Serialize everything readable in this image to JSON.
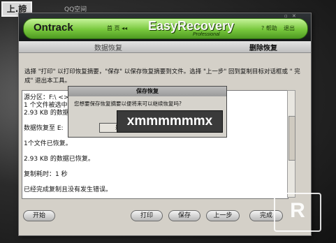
{
  "background": {
    "badge": "上.諦",
    "title": "QQ空间"
  },
  "header": {
    "brand_left": "Ontrack",
    "home_label": "首 页 ◂◂",
    "brand_main": "EasyRecovery",
    "brand_sub": "Professional",
    "help_label": "? 帮助",
    "exit_label": "退出",
    "window_controls": "▫ ✕"
  },
  "subheader": {
    "breadcrumb": "数据恢复",
    "page_title": "删除恢复"
  },
  "instructions": "选择 \"打印\" 以打印恢复摘要，\"保存\" 以保存恢复摘要到文件。选择 \"上一步\" 回到复制目标对话框或 \" 完成\" 退出本工具。",
  "result": {
    "lines": [
      "源分区：F:\\ <>",
      "1 个文件被选中",
      "2.93 KB 的数据",
      "数据恢复至 E:",
      "1个文件已恢复。",
      "2.93 KB 的数据已恢复。",
      "复制耗时：1 秒",
      "已经完成复制且没有发生错误。"
    ]
  },
  "dialog": {
    "title": "保存恢复",
    "message": "您想要保存恢复摘要以便将来可以继续恢复吗?",
    "yes_label": "是",
    "no_label": "否"
  },
  "overlay_text": "xmmmmmmx",
  "buttons": {
    "start_label": "开始",
    "print_label": "打印",
    "save_label": "保存",
    "back_label": "上一步",
    "finish_label": "完成"
  },
  "watermark": "R"
}
